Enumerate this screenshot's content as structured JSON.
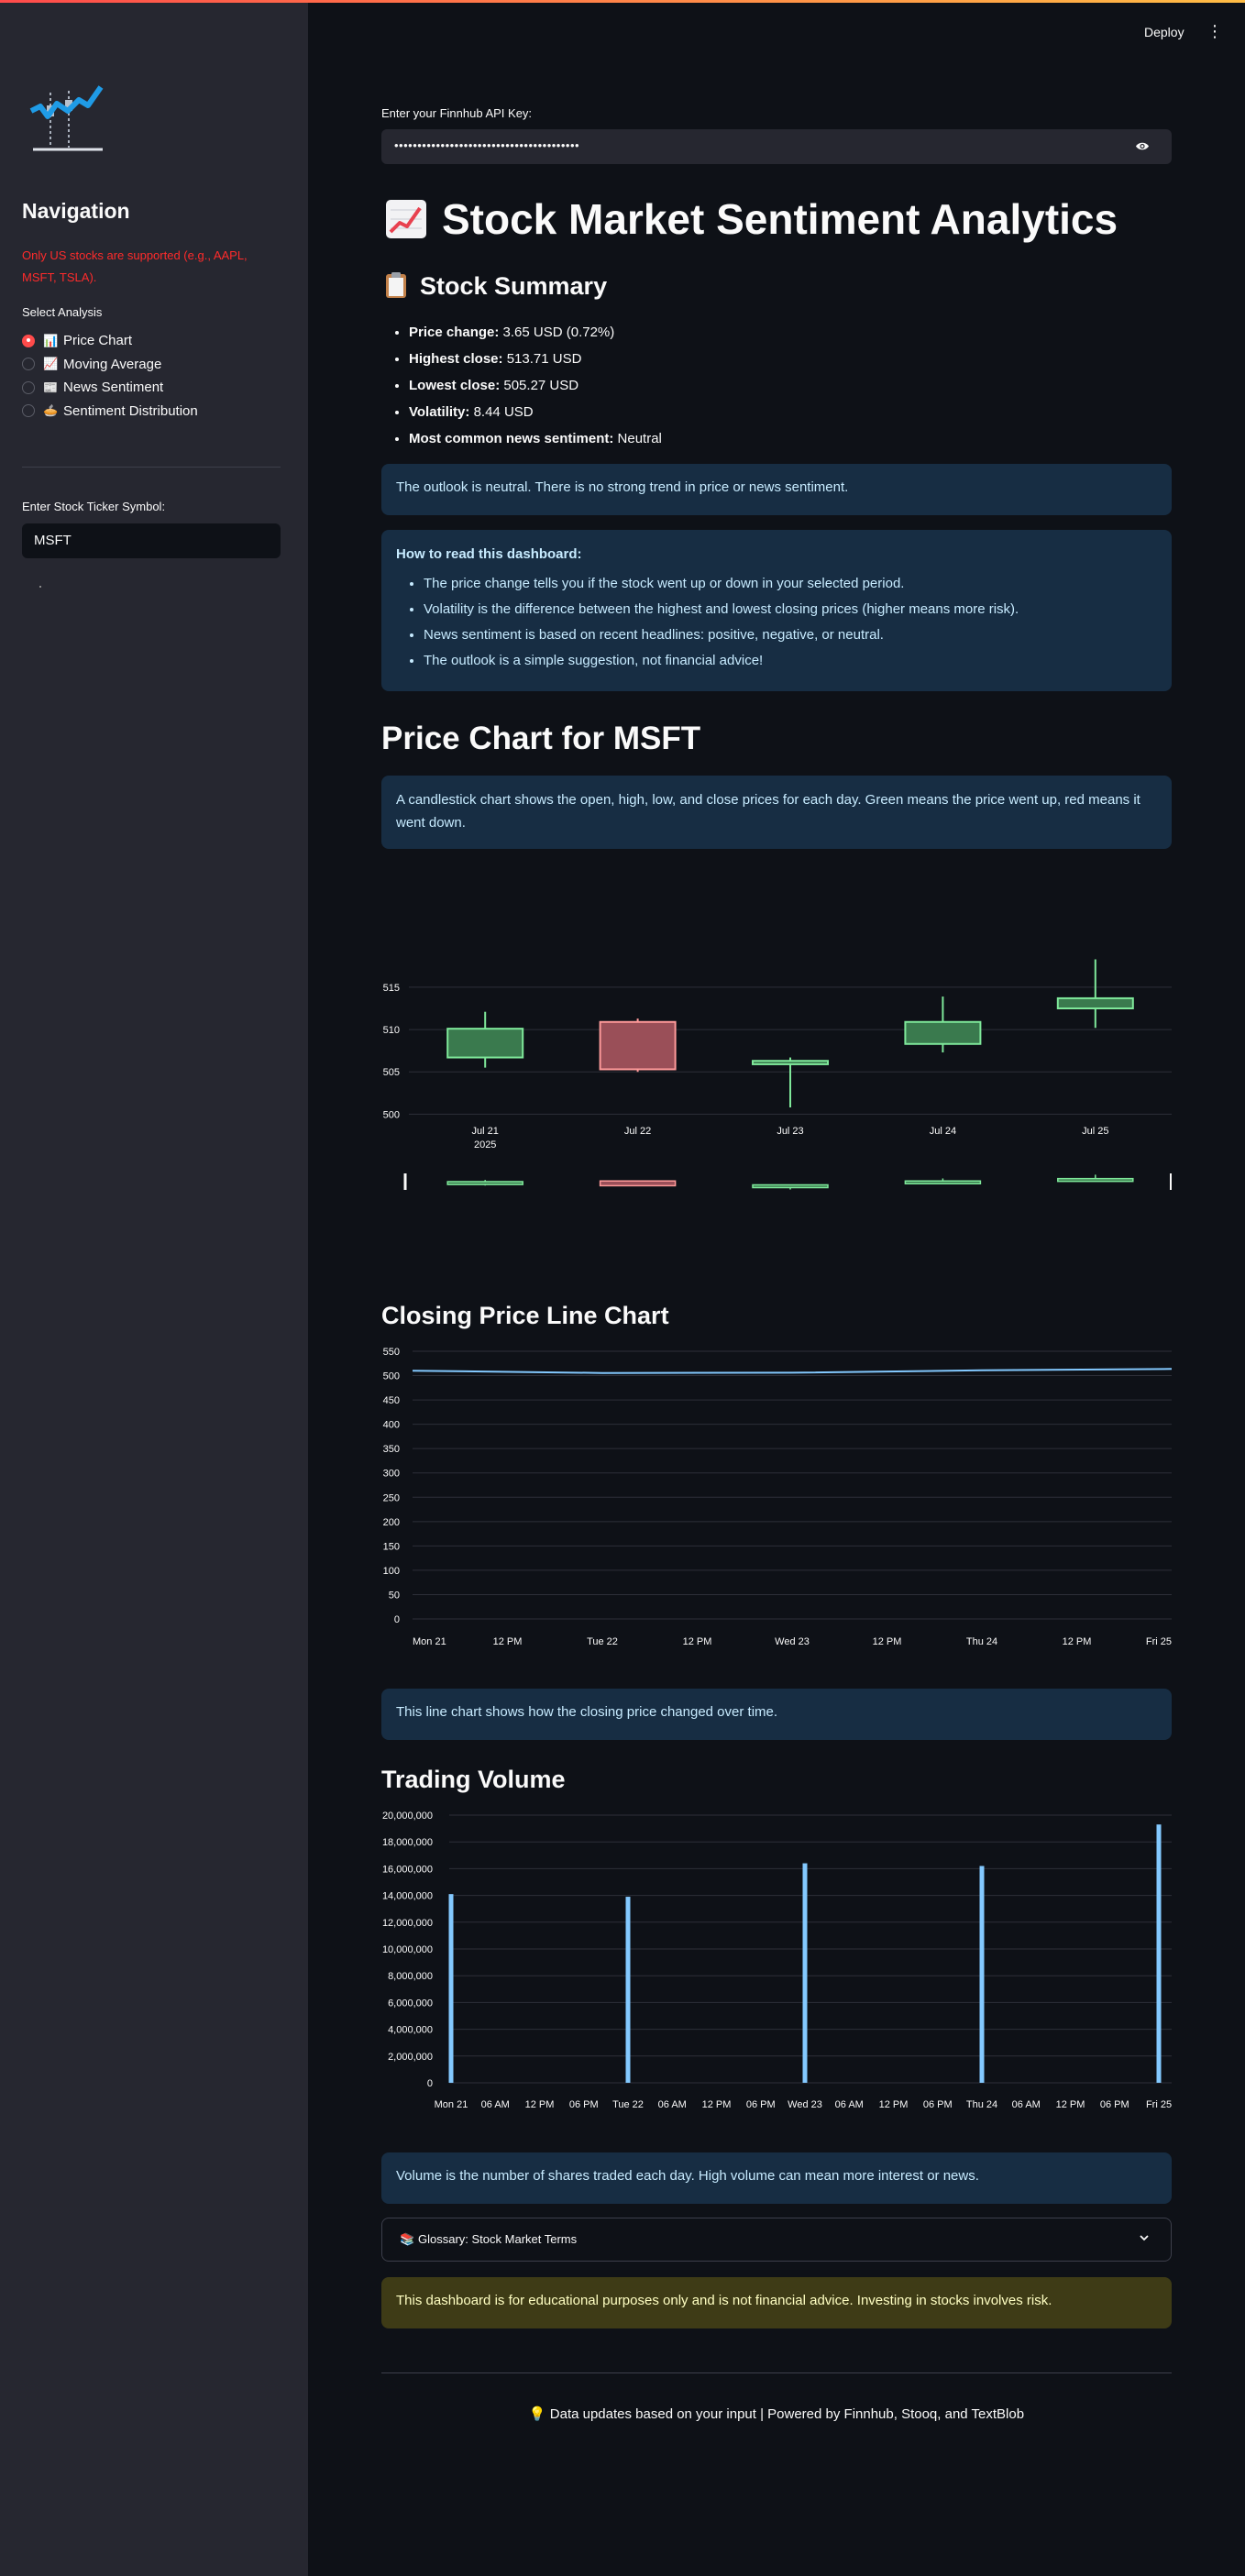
{
  "header": {
    "deploy_label": "Deploy",
    "menu_icon": "kebab-menu-icon"
  },
  "sidebar": {
    "logo_icon": "stock-chart-logo-icon",
    "nav_title": "Navigation",
    "warning": "Only US stocks are supported (e.g., AAPL, MSFT, TSLA).",
    "select_label": "Select Analysis",
    "options": [
      {
        "label": "Price Chart",
        "emoji": "📊",
        "selected": true
      },
      {
        "label": "Moving Average",
        "emoji": "📈",
        "selected": false
      },
      {
        "label": "News Sentiment",
        "emoji": "📰",
        "selected": false
      },
      {
        "label": "Sentiment Distribution",
        "emoji": "🥧",
        "selected": false
      }
    ],
    "ticker_label": "Enter Stock Ticker Symbol:",
    "ticker_value": "MSFT"
  },
  "api": {
    "label": "Enter your Finnhub API Key:",
    "value": "••••••••••••••••••••••••••••••••••••••••"
  },
  "title": "Stock Market Sentiment Analytics",
  "summary": {
    "heading": "Stock Summary",
    "items": [
      {
        "label": "Price change:",
        "value": "3.65 USD (0.72%)"
      },
      {
        "label": "Highest close:",
        "value": "513.71 USD"
      },
      {
        "label": "Lowest close:",
        "value": "505.27 USD"
      },
      {
        "label": "Volatility:",
        "value": "8.44 USD"
      },
      {
        "label": "Most common news sentiment:",
        "value": "Neutral"
      }
    ]
  },
  "outlook": "The outlook is neutral. There is no strong trend in price or news sentiment.",
  "howto": {
    "title": "How to read this dashboard:",
    "items": [
      "The price change tells you if the stock went up or down in your selected period.",
      "Volatility is the difference between the highest and lowest closing prices (higher means more risk).",
      "News sentiment is based on recent headlines: positive, negative, or neutral.",
      "The outlook is a simple suggestion, not financial advice!"
    ]
  },
  "price_chart": {
    "heading": "Price Chart for MSFT",
    "info": "A candlestick chart shows the open, high, low, and close prices for each day. Green means the price went up, red means it went down."
  },
  "line_chart": {
    "heading": "Closing Price Line Chart",
    "info": "This line chart shows how the closing price changed over time."
  },
  "volume_chart": {
    "heading": "Trading Volume",
    "info": "Volume is the number of shares traded each day. High volume can mean more interest or news."
  },
  "glossary": {
    "label": "Glossary: Stock Market Terms",
    "icon": "📚"
  },
  "disclaimer": "This dashboard is for educational purposes only and is not financial advice. Investing in stocks involves risk.",
  "footer": {
    "icon": "💡",
    "text": "Data updates based on your input | Powered by Finnhub, Stooq, and TextBlob"
  },
  "colors": {
    "up": "#7fe89a",
    "down": "#ff9a9a",
    "line": "#83c9ff",
    "accent": "#ff4b4b"
  },
  "chart_data": [
    {
      "type": "candlestick",
      "categories": [
        "Jul 21",
        "Jul 22",
        "Jul 23",
        "Jul 24",
        "Jul 25"
      ],
      "year_label": "2025",
      "open": [
        506.7,
        510.9,
        505.9,
        508.3,
        512.5
      ],
      "high": [
        512.1,
        511.3,
        506.7,
        513.9,
        518.3
      ],
      "low": [
        505.5,
        505.0,
        500.8,
        507.3,
        510.2
      ],
      "close": [
        510.1,
        505.3,
        506.3,
        510.9,
        513.7
      ],
      "yticks": [
        500,
        505,
        510,
        515
      ],
      "ylim": [
        499.5,
        519
      ],
      "rangeslider": true
    },
    {
      "type": "line",
      "x": [
        "Mon 21",
        "12 PM",
        "Tue 22",
        "12 PM",
        "Wed 23",
        "12 PM",
        "Thu 24",
        "12 PM",
        "Fri 25"
      ],
      "values": [
        510.06,
        505.27,
        505.87,
        510.88,
        513.71
      ],
      "yticks": [
        0,
        50,
        100,
        150,
        200,
        250,
        300,
        350,
        400,
        450,
        500,
        550
      ],
      "ylim": [
        0,
        550
      ]
    },
    {
      "type": "bar",
      "x": [
        "Mon 21",
        "06 AM",
        "12 PM",
        "06 PM",
        "Tue 22",
        "06 AM",
        "12 PM",
        "06 PM",
        "Wed 23",
        "06 AM",
        "12 PM",
        "06 PM",
        "Thu 24",
        "06 AM",
        "12 PM",
        "06 PM",
        "Fri 25"
      ],
      "categories": [
        "Mon 21",
        "Tue 22",
        "Wed 23",
        "Thu 24",
        "Fri 25"
      ],
      "values": [
        14100000,
        13900000,
        16400000,
        16200000,
        19300000
      ],
      "yticks": [
        "0",
        "2,000,000",
        "4,000,000",
        "6,000,000",
        "8,000,000",
        "10,000,000",
        "12,000,000",
        "14,000,000",
        "16,000,000",
        "18,000,000",
        "20,000,000"
      ],
      "ylim": [
        0,
        20000000
      ]
    }
  ]
}
